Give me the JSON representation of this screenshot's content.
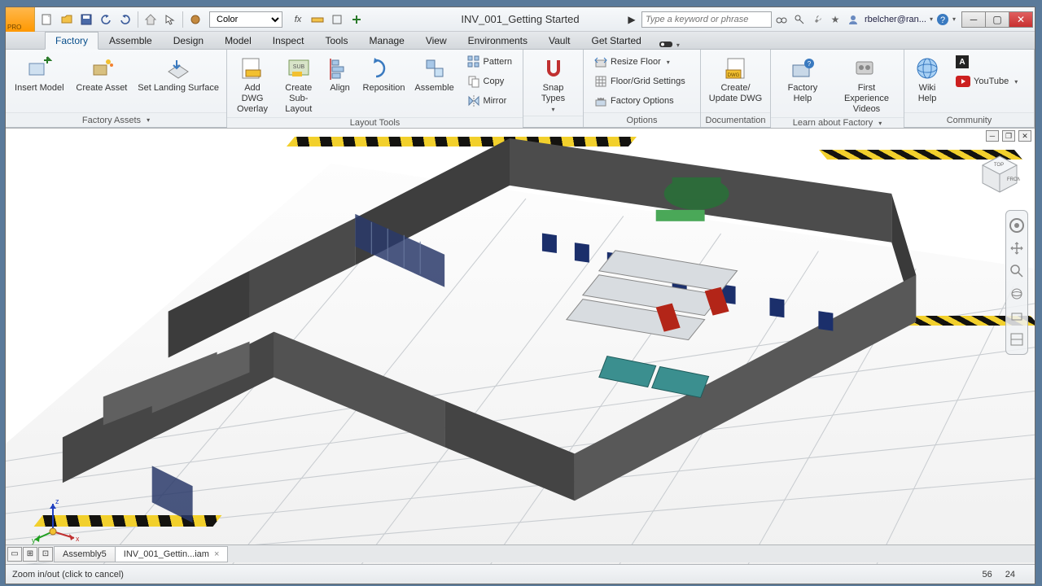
{
  "app": {
    "pro_badge": "PRO"
  },
  "titlebar": {
    "title": "INV_001_Getting Started",
    "color_mode": "Color",
    "search_placeholder": "Type a keyword or phrase",
    "user": "rbelcher@ran..."
  },
  "tabs": {
    "items": [
      "Factory",
      "Assemble",
      "Design",
      "Model",
      "Inspect",
      "Tools",
      "Manage",
      "View",
      "Environments",
      "Vault",
      "Get Started"
    ],
    "active_index": 0
  },
  "ribbon": {
    "factory_assets": {
      "title": "Factory Assets",
      "insert_model": "Insert Model",
      "create_asset": "Create Asset",
      "set_landing": "Set Landing Surface"
    },
    "layout_tools": {
      "title": "Layout Tools",
      "add_dwg_overlay": "Add DWG Overlay",
      "create_sublayout": "Create Sub-Layout",
      "align": "Align",
      "reposition": "Reposition",
      "assemble": "Assemble",
      "pattern": "Pattern",
      "copy": "Copy",
      "mirror": "Mirror"
    },
    "snap": {
      "label": "Snap Types"
    },
    "options": {
      "title": "Options",
      "resize_floor": "Resize Floor",
      "floor_grid": "Floor/Grid Settings",
      "factory_options": "Factory Options"
    },
    "documentation": {
      "title": "Documentation",
      "create_update_dwg": "Create/ Update DWG"
    },
    "learn": {
      "title": "Learn about Factory",
      "factory_help": "Factory Help",
      "first_experience": "First Experience Videos"
    },
    "community": {
      "title": "Community",
      "wiki_help": "Wiki Help",
      "youtube": "YouTube"
    }
  },
  "doc_tabs": {
    "items": [
      {
        "label": "Assembly5"
      },
      {
        "label": "INV_001_Gettin...iam"
      }
    ],
    "active_index": 1
  },
  "status": {
    "message": "Zoom in/out (click to cancel)",
    "coord_a": "56",
    "coord_b": "24"
  },
  "axis": {
    "x": "x",
    "y": "y",
    "z": "z"
  }
}
